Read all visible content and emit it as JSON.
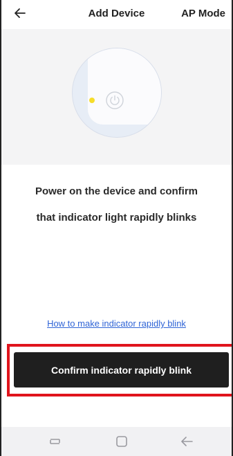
{
  "header": {
    "back_icon": "back-arrow-icon",
    "title": "Add Device",
    "mode_label": "AP Mode"
  },
  "illustration": {
    "indicator_color": "#f6dd2a",
    "power_icon": "power-icon"
  },
  "instruction": {
    "line1": "Power on the device and confirm",
    "line2": "that indicator light rapidly blinks"
  },
  "help_link": "How to make indicator rapidly blink",
  "confirm_button": "Confirm indicator rapidly blink",
  "colors": {
    "button_bg": "#1f1f1f",
    "link": "#2f64d6",
    "highlight": "#e0141d",
    "illustration_bg": "#f4f4f5"
  },
  "nav_bar": {
    "recent_icon": "recent-apps-icon",
    "home_icon": "home-icon",
    "back_icon": "nav-back-icon"
  }
}
